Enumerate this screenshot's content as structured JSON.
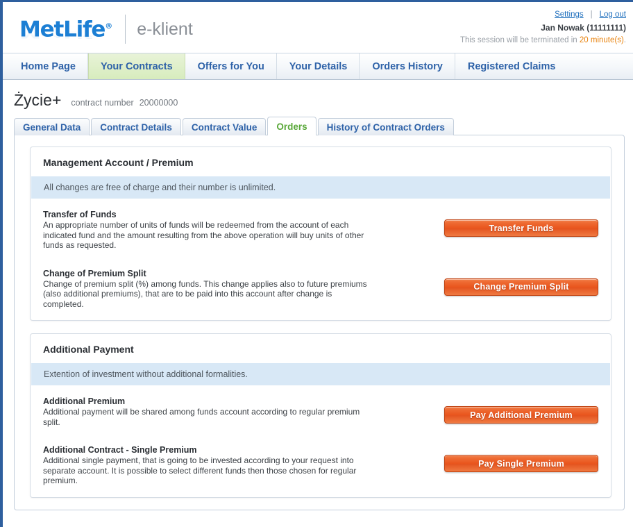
{
  "header": {
    "logo_text": "MetLife",
    "logo_registered": "®",
    "subtitle": "e-klient",
    "settings_label": "Settings",
    "separator": "|",
    "logout_label": "Log out",
    "user": "Jan Nowak (11111111)",
    "session_prefix": "This session will be terminated in ",
    "session_time": "20 minute(s)",
    "session_suffix": ".",
    "accent_blue": "#1c7fd4",
    "accent_orange": "#e8820c"
  },
  "mainnav": {
    "items": [
      {
        "label": "Home Page",
        "active": false
      },
      {
        "label": "Your Contracts",
        "active": true
      },
      {
        "label": "Offers for You",
        "active": false
      },
      {
        "label": "Your Details",
        "active": false
      },
      {
        "label": "Orders History",
        "active": false
      },
      {
        "label": "Registered Claims",
        "active": false
      }
    ]
  },
  "contract": {
    "name": "Życie+",
    "number_label": "contract number",
    "number": "20000000"
  },
  "subtabs": {
    "items": [
      {
        "label": "General Data",
        "active": false
      },
      {
        "label": "Contract Details",
        "active": false
      },
      {
        "label": "Contract Value",
        "active": false
      },
      {
        "label": "Orders",
        "active": true
      },
      {
        "label": "History of Contract Orders",
        "active": false
      }
    ],
    "active_color": "#5aa83a",
    "inactive_color": "#2e62a8"
  },
  "panels": [
    {
      "title": "Management Account / Premium",
      "banner": "All changes are free of charge and their number is unlimited.",
      "rows": [
        {
          "title": "Transfer of Funds",
          "desc": "An appropriate number of units of funds will be redeemed from the account of each indicated fund and the amount resulting from the above operation will buy units of other funds as requested.",
          "button": "Transfer Funds"
        },
        {
          "title": "Change of Premium Split",
          "desc": "Change of premium split (%) among funds. This change applies also to future premiums (also additional premiums), that are to be paid into this account after change is completed.",
          "button": "Change Premium Split"
        }
      ]
    },
    {
      "title": "Additional Payment",
      "banner": "Extention of investment without additional formalities.",
      "rows": [
        {
          "title": "Additional Premium",
          "desc": "Additional payment will be shared among funds account according to regular premium split.",
          "button": "Pay Additional Premium"
        },
        {
          "title": "Additional Contract - Single Premium",
          "desc": "Additional single payment, that is going to be invested according to your request into separate account. It is possible to select different funds then those chosen for regular premium.",
          "button": "Pay Single Premium"
        }
      ]
    }
  ]
}
